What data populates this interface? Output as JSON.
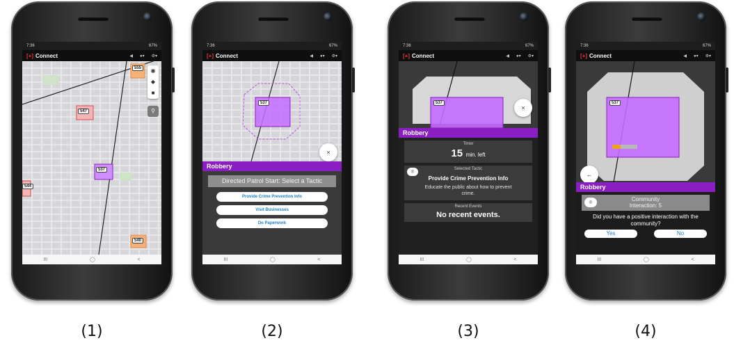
{
  "common": {
    "status_time": "7:36",
    "status_right": "67%",
    "app_name": "Connect",
    "logo_mark": "[+]",
    "nav_recent": "III",
    "nav_home": "◯",
    "nav_back": "<"
  },
  "labels": [
    "(1)",
    "(2)",
    "(3)",
    "(4)"
  ],
  "screen1": {
    "beats": [
      "555",
      "547",
      "537",
      "544",
      "540"
    ],
    "map_tools": [
      "layers-icon",
      "tag-icon",
      "list-icon",
      "pin-icon"
    ]
  },
  "screen2": {
    "beat": "537",
    "close": "×",
    "banner": "Robbery",
    "prompt": "Directed Patrol Start: Select a Tactic",
    "tactics": [
      "Provide Crime Prevention Info",
      "Visit Businesses",
      "Do Paperwork"
    ]
  },
  "screen3": {
    "beat": "537",
    "close": "×",
    "banner": "Robbery",
    "timer_label": "Timer",
    "timer_value": "15",
    "timer_unit": "min. left",
    "selected_label": "Selected Tactic",
    "tactic": "Provide Crime Prevention Info",
    "tactic_desc": "Educate the public about how to prevent crime.",
    "recent_label": "Recent Events",
    "recent_value": "No recent events."
  },
  "screen4": {
    "beat": "537",
    "back": "←",
    "banner": "Robbery",
    "community_title": "Community",
    "community_count": "Interaction: 5",
    "question": "Did you have a positive interaction with the community?",
    "yes": "Yes",
    "no": "No"
  },
  "colors": {
    "accent_purple": "#8a1ec2",
    "polygon_fill": "#c46cff",
    "beat_red": "#d94a4a",
    "beat_orange": "#e8893a",
    "link_blue": "#1a7fc1"
  }
}
